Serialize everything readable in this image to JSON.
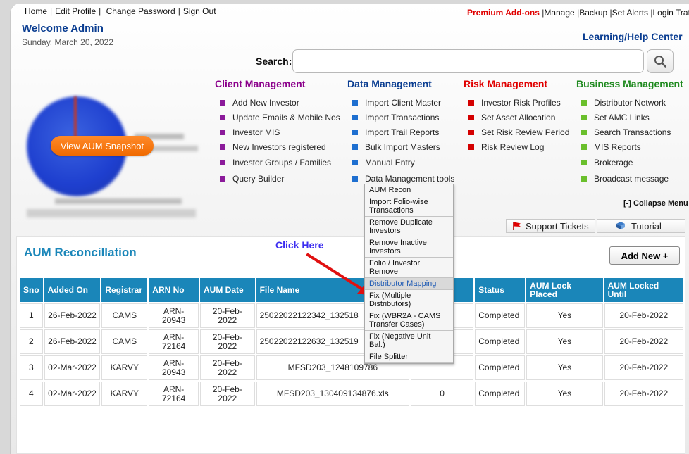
{
  "top_links_left": [
    "Home",
    "Edit Profile",
    "Change Password",
    "Sign Out"
  ],
  "top_links_right": {
    "premium": "Premium Add-ons",
    "links": [
      "Manage",
      "Backup",
      "Set Alerts",
      "Login Traffic"
    ]
  },
  "welcome": "Welcome Admin",
  "date": "Sunday, March 20, 2022",
  "help_center": "Learning/Help Center",
  "search": {
    "label": "Search:",
    "value": "",
    "placeholder": ""
  },
  "snapshot_button": "View AUM Snapshot",
  "menus": [
    {
      "title": "Client Management",
      "color": "#8b008b",
      "items": [
        "Add New Investor",
        "Update Emails & Mobile Nos",
        "Investor MIS",
        "New Investors registered",
        "Investor Groups / Families",
        "Query Builder"
      ]
    },
    {
      "title": "Data Management",
      "color": "#0a3d91",
      "bullet": "#1e6fd0",
      "items": [
        "Import Client Master",
        "Import Transactions",
        "Import Trail Reports",
        "Bulk Import Masters",
        "Manual Entry",
        "Data Management tools"
      ]
    },
    {
      "title": "Risk Management",
      "color": "#e00000",
      "items": [
        "Investor Risk Profiles",
        "Set Asset Allocation",
        "Set Risk Review Period",
        "Risk Review Log"
      ]
    },
    {
      "title": "Business Management",
      "color": "#1f8a1f",
      "bullet": "#6abf2c",
      "items": [
        "Distributor Network",
        "Set AMC Links",
        "Search Transactions",
        "MIS Reports",
        "Brokerage",
        "Broadcast message"
      ]
    }
  ],
  "collapse_menu": "[-] Collapse Menu",
  "support_tickets": "Support Tickets",
  "tutorial": "Tutorial",
  "aum_title": "AUM Reconcillation",
  "click_here": "Click Here",
  "add_new": "Add New +",
  "dropdown_items": [
    "AUM Recon",
    "Import Folio-wise Transactions",
    "Remove Duplicate Investors",
    "Remove Inactive Investors",
    "Folio / Investor Remove",
    "Distributor Mapping",
    "Fix (Multiple Distributors)",
    "Fix (WBR2A - CAMS Transfer Cases)",
    "Fix (Negative Unit Bal.)",
    "File Splitter"
  ],
  "dropdown_active": "Distributor Mapping",
  "table": {
    "headers": [
      "Sno",
      "Added On",
      "Registrar",
      "ARN No",
      "AUM Date",
      "File Name",
      "",
      "Status",
      "AUM Lock Placed",
      "AUM Locked Until"
    ],
    "rows": [
      [
        "1",
        "26-Feb-2022",
        "CAMS",
        "ARN-20943",
        "20-Feb-2022",
        "25022022122342_132518",
        "",
        "Completed",
        "Yes",
        "20-Feb-2022"
      ],
      [
        "2",
        "26-Feb-2022",
        "CAMS",
        "ARN-72164",
        "20-Feb-2022",
        "25022022122632_132519",
        "",
        "Completed",
        "Yes",
        "20-Feb-2022"
      ],
      [
        "3",
        "02-Mar-2022",
        "KARVY",
        "ARN-20943",
        "20-Feb-2022",
        "MFSD203_1248109786",
        "",
        "Completed",
        "Yes",
        "20-Feb-2022"
      ],
      [
        "4",
        "02-Mar-2022",
        "KARVY",
        "ARN-72164",
        "20-Feb-2022",
        "MFSD203_130409134876.xls",
        "0",
        "Completed",
        "Yes",
        "20-Feb-2022"
      ]
    ]
  }
}
